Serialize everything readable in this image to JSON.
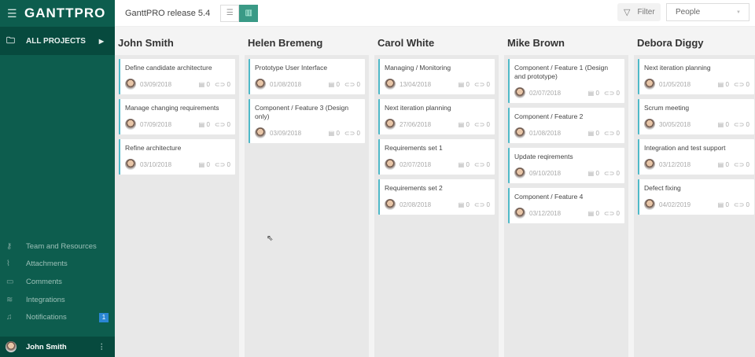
{
  "app": {
    "logo": "GANTTPRO",
    "project_title": "GanttPRO release 5.4"
  },
  "sidebar": {
    "all_projects": "ALL PROJECTS",
    "items": [
      {
        "label": "Team and Resources",
        "icon": "key-icon"
      },
      {
        "label": "Attachments",
        "icon": "paperclip-icon"
      },
      {
        "label": "Comments",
        "icon": "comment-icon"
      },
      {
        "label": "Integrations",
        "icon": "layers-icon"
      },
      {
        "label": "Notifications",
        "icon": "bell-icon",
        "badge": "1"
      }
    ],
    "user": "John Smith"
  },
  "toolbar": {
    "filter": "Filter",
    "group_select": "People"
  },
  "colors": {
    "sidebar": "#0d5d4e",
    "accent": "#3a9a86",
    "card_border": "#4fb9c8",
    "badge": "#2a86d4"
  },
  "columns": [
    {
      "name": "John Smith",
      "cards": [
        {
          "title": "Define candidate architecture",
          "date": "03/09/2018",
          "comments": "0",
          "attachments": "0"
        },
        {
          "title": "Manage changing requirements",
          "date": "07/09/2018",
          "comments": "0",
          "attachments": "0"
        },
        {
          "title": "Refine architecture",
          "date": "03/10/2018",
          "comments": "0",
          "attachments": "0"
        }
      ]
    },
    {
      "name": "Helen Bremeng",
      "cards": [
        {
          "title": "Prototype User Interface",
          "date": "01/08/2018",
          "comments": "0",
          "attachments": "0"
        },
        {
          "title": "Component / Feature 3 (Design only)",
          "date": "03/09/2018",
          "comments": "0",
          "attachments": "0"
        }
      ]
    },
    {
      "name": "Carol White",
      "cards": [
        {
          "title": "Managing / Monitoring",
          "date": "13/04/2018",
          "comments": "0",
          "attachments": "0"
        },
        {
          "title": "Next iteration planning",
          "date": "27/06/2018",
          "comments": "0",
          "attachments": "0"
        },
        {
          "title": "Requirements set 1",
          "date": "02/07/2018",
          "comments": "0",
          "attachments": "0"
        },
        {
          "title": "Requirements set 2",
          "date": "02/08/2018",
          "comments": "0",
          "attachments": "0"
        }
      ]
    },
    {
      "name": "Mike Brown",
      "cards": [
        {
          "title": "Component / Feature 1 (Design and prototype)",
          "date": "02/07/2018",
          "comments": "0",
          "attachments": "0"
        },
        {
          "title": "Component / Feature 2",
          "date": "01/08/2018",
          "comments": "0",
          "attachments": "0"
        },
        {
          "title": "Update reqirements",
          "date": "09/10/2018",
          "comments": "0",
          "attachments": "0"
        },
        {
          "title": "Component / Feature 4",
          "date": "03/12/2018",
          "comments": "0",
          "attachments": "0"
        }
      ]
    },
    {
      "name": "Debora Diggy",
      "cards": [
        {
          "title": "Next iteration planning",
          "date": "01/05/2018",
          "comments": "0",
          "attachments": "0"
        },
        {
          "title": "Scrum meeting",
          "date": "30/05/2018",
          "comments": "0",
          "attachments": "0"
        },
        {
          "title": "Integration and test support",
          "date": "03/12/2018",
          "comments": "0",
          "attachments": "0"
        },
        {
          "title": "Defect fixing",
          "date": "04/02/2019",
          "comments": "0",
          "attachments": "0"
        }
      ]
    }
  ]
}
